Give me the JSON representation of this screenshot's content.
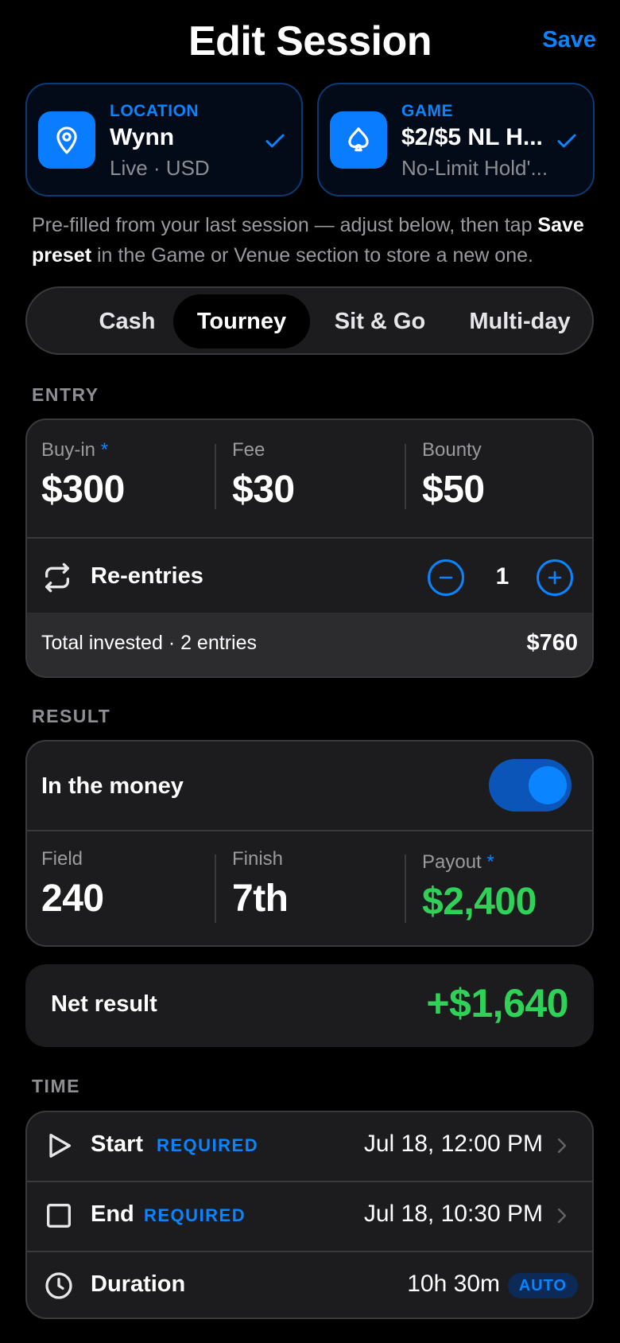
{
  "header": {
    "title": "Edit Session",
    "save_label": "Save"
  },
  "location": {
    "kicker": "LOCATION",
    "name": "Wynn",
    "sub": "Live · USD",
    "icon": "map-pin-icon"
  },
  "game": {
    "kicker": "GAME",
    "name": "$2/$5 NL H...",
    "sub": "No-Limit Hold'...",
    "icon": "spade-icon"
  },
  "hint": {
    "prefix": "Pre-filled from your last session — adjust below, then tap ",
    "strong": "Save preset",
    "suffix": " in the Game or Venue section to store a new one."
  },
  "segments": {
    "items": [
      "Cash",
      "Tourney",
      "Sit & Go",
      "Multi-day"
    ],
    "active": "Tourney"
  },
  "entry": {
    "section_label": "ENTRY",
    "buyin": {
      "label": "Buy-in",
      "required_mark": "*",
      "value": "$300"
    },
    "fee": {
      "label": "Fee",
      "value": "$30"
    },
    "bounty": {
      "label": "Bounty",
      "value": "$50"
    },
    "reentries": {
      "label": "Re-entries",
      "count": "1"
    },
    "total": {
      "label": "Total invested · 2 entries",
      "value": "$760"
    }
  },
  "result": {
    "section_label": "RESULT",
    "itm": {
      "label": "In the money",
      "on": true
    },
    "field": {
      "label": "Field",
      "value": "240"
    },
    "finish": {
      "label": "Finish",
      "value": "7th"
    },
    "payout": {
      "label": "Payout",
      "required_mark": "*",
      "value": "$2,400"
    }
  },
  "net": {
    "label": "Net result",
    "value": "+$1,640"
  },
  "time": {
    "section_label": "TIME",
    "start": {
      "label": "Start",
      "badge": "REQUIRED",
      "value": "Jul 18, 12:00 PM"
    },
    "end": {
      "label": "End",
      "badge": "REQUIRED",
      "value": "Jul 18, 10:30 PM"
    },
    "duration": {
      "label": "Duration",
      "value": "10h 30m",
      "badge": "AUTO"
    }
  },
  "colors": {
    "accent": "#0a84ff",
    "positive": "#30d158",
    "background": "#000000",
    "card": "#1c1c1e"
  }
}
